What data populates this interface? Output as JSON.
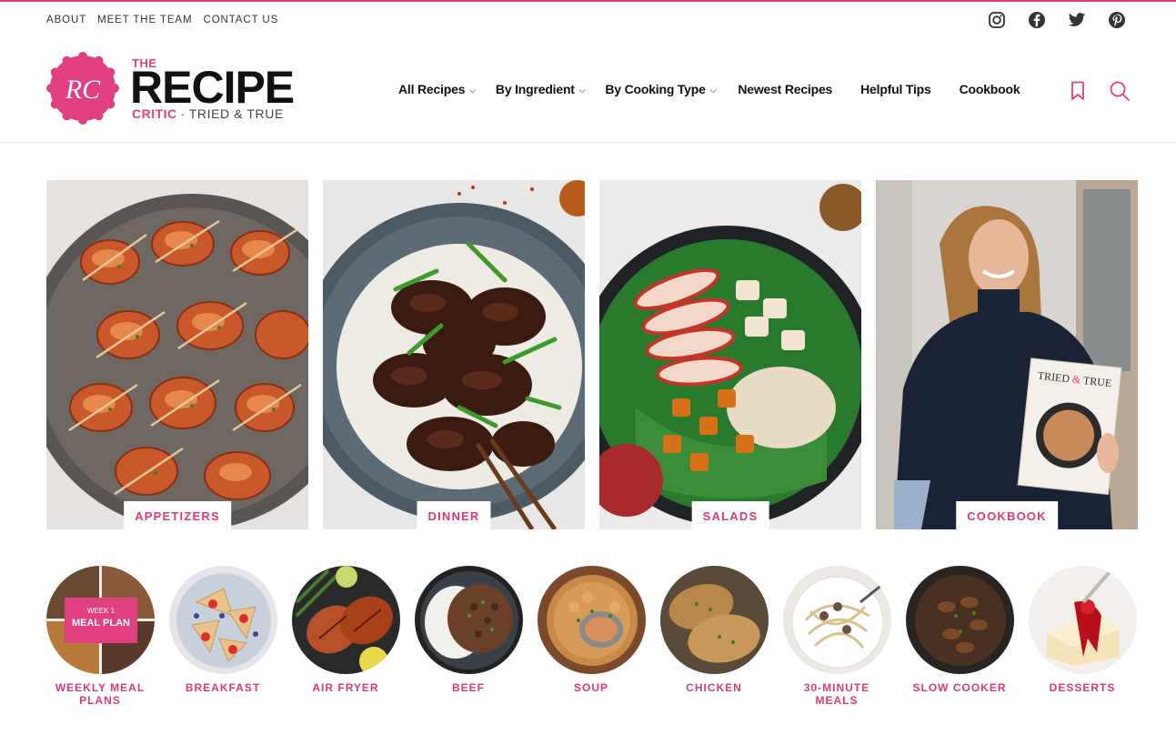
{
  "utility_nav": [
    "ABOUT",
    "MEET THE TEAM",
    "CONTACT US"
  ],
  "social_icons": [
    "instagram-icon",
    "facebook-icon",
    "twitter-icon",
    "pinterest-icon"
  ],
  "logo": {
    "monogram": "RC",
    "the": "THE",
    "recipe": "RECIPE",
    "critic": "CRITIC",
    "separator": "·",
    "tagline": "TRIED & TRUE"
  },
  "main_nav": [
    {
      "label": "All Recipes",
      "dropdown": true
    },
    {
      "label": "By Ingredient",
      "dropdown": true
    },
    {
      "label": "By Cooking Type",
      "dropdown": true
    },
    {
      "label": "Newest Recipes",
      "dropdown": false
    },
    {
      "label": "Helpful Tips",
      "dropdown": false
    },
    {
      "label": "Cookbook",
      "dropdown": false
    }
  ],
  "header_icons": [
    "bookmark-icon",
    "search-icon"
  ],
  "featured_tiles": [
    {
      "label": "APPETIZERS"
    },
    {
      "label": "DINNER"
    },
    {
      "label": "SALADS"
    },
    {
      "label": "COOKBOOK"
    }
  ],
  "cookbook_cover": {
    "title_a": "TRIED",
    "title_b": "TRUE"
  },
  "meal_plan_badge": {
    "line1": "WEEK 1",
    "line2": "MEAL PLAN"
  },
  "categories": [
    {
      "label": "WEEKLY MEAL PLANS"
    },
    {
      "label": "BREAKFAST"
    },
    {
      "label": "AIR FRYER"
    },
    {
      "label": "BEEF"
    },
    {
      "label": "SOUP"
    },
    {
      "label": "CHICKEN"
    },
    {
      "label": "30-MINUTE MEALS"
    },
    {
      "label": "SLOW COOKER"
    },
    {
      "label": "DESSERTS"
    }
  ],
  "colors": {
    "brand_pink": "#e0407f",
    "label_pink": "#d93b7a",
    "text": "#111111"
  }
}
